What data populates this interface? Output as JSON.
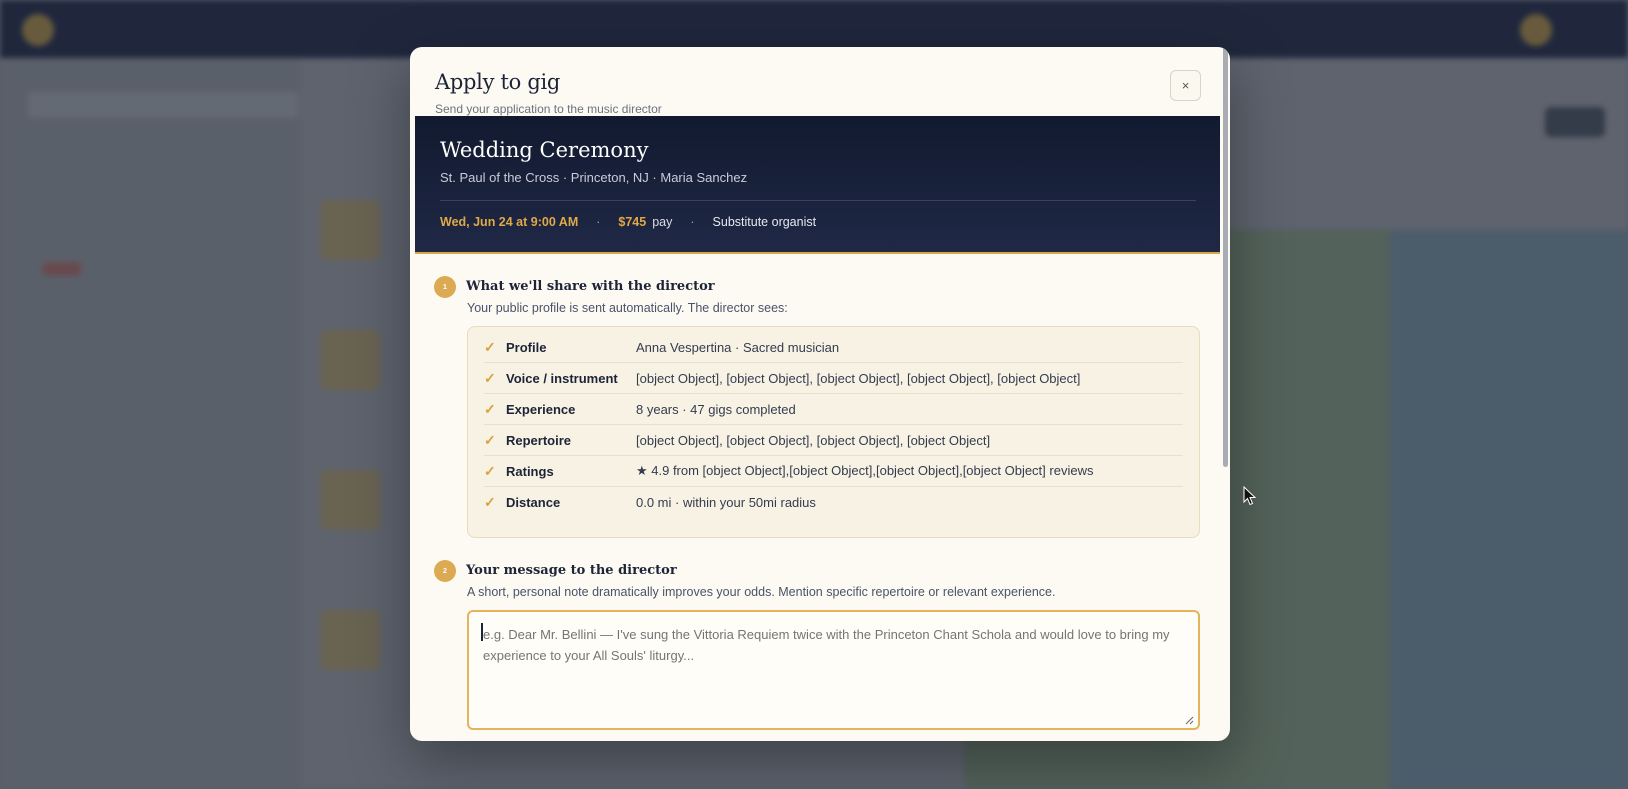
{
  "colors": {
    "accent": "#dcaa52",
    "navy": "#1d2437",
    "cream": "#fcfaf3"
  },
  "modal": {
    "title": "Apply to gig",
    "subtitle": "Send your application to the music director",
    "close_label": "×"
  },
  "gig": {
    "title": "Wedding Ceremony",
    "meta": "St. Paul of the Cross · Princeton, NJ · Maria Sanchez",
    "date": "Wed, Jun 24 at 9:00 AM",
    "separator": "·",
    "pay_amount": "$745",
    "pay_label": "pay",
    "role": "Substitute organist"
  },
  "section1": {
    "number": "1",
    "title": "What we'll share with the director",
    "description": "Your public profile is sent automatically. The director sees:",
    "check_icon": "✓",
    "rows": [
      {
        "label": "Profile",
        "value": "Anna Vespertina · Sacred musician"
      },
      {
        "label": "Voice / instrument",
        "value": "[object Object], [object Object], [object Object], [object Object], [object Object]"
      },
      {
        "label": "Experience",
        "value": "8 years · 47 gigs completed"
      },
      {
        "label": "Repertoire",
        "value": "[object Object], [object Object], [object Object], [object Object]"
      },
      {
        "label": "Ratings",
        "value": "★ 4.9 from [object Object],[object Object],[object Object],[object Object] reviews"
      },
      {
        "label": "Distance",
        "value": "0.0 mi · within your 50mi radius"
      }
    ]
  },
  "section2": {
    "number": "2",
    "title": "Your message to the director",
    "description": "A short, personal note dramatically improves your odds. Mention specific repertoire or relevant experience.",
    "placeholder": "e.g. Dear Mr. Bellini — I've sung the Vittoria Requiem twice with the Princeton Chant Schola and would love to bring my experience to your All Souls' liturgy..."
  }
}
